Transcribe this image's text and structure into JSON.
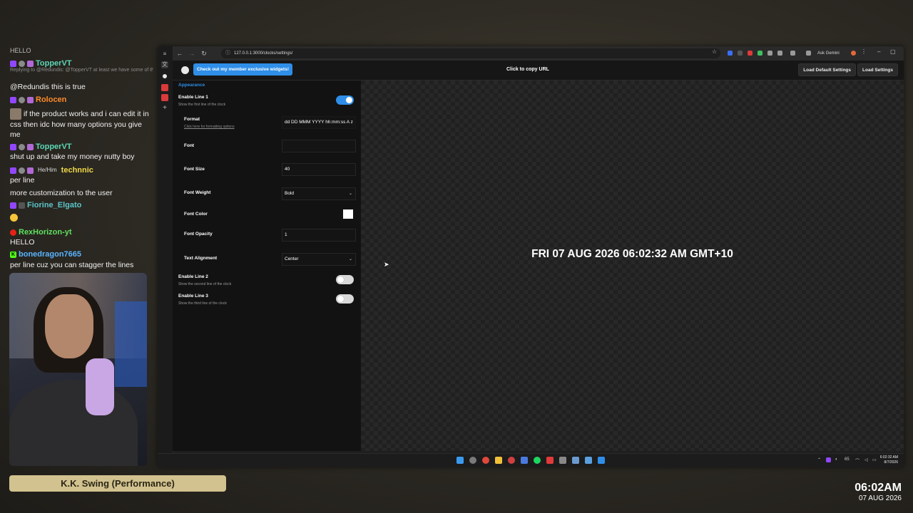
{
  "chat": {
    "top_fragment": "HELLO",
    "messages": [
      {
        "user": "TopperVT",
        "color": "#5cd6b6",
        "reply_text": "Replying to @Redundis: @TopperVT at least we have some of the best musical artists in town",
        "text": "@Redundis this is true"
      },
      {
        "user": "Rolocen",
        "color": "#ff8a2b",
        "text": "if the product works and i can edit it in css then idc how many options you give me"
      },
      {
        "user": "TopperVT",
        "color": "#5cd6b6",
        "text": "shut up and take my money nutty boy"
      },
      {
        "user": "technnic",
        "color": "#f0d84a",
        "pronoun": "He/Him",
        "text": "per line"
      },
      {
        "user": "",
        "text": "more customization to the user"
      },
      {
        "user": "Fiorine_Elgato",
        "color": "#5cc4c8",
        "text": ""
      },
      {
        "user": "RexHorizon-yt",
        "color": "#5fe05f",
        "text": "HELLO"
      },
      {
        "user": "bonedragon7665",
        "color": "#5ab4ff",
        "text": "per line cuz you can stagger the lines"
      }
    ]
  },
  "now_playing": "K.K. Swing (Performance)",
  "stream_clock": {
    "time": "06:02AM",
    "date": "07 AUG 2026"
  },
  "browser": {
    "url": "127.0.0.1:3000/clocks/settings/",
    "ask_gemini": "Ask Gemini",
    "header": {
      "member_button": "Check out my member exclusive widgets!",
      "copy_url": "Click to copy URL",
      "load_default": "Load Default Settings",
      "load_settings": "Load Settings"
    },
    "panel": {
      "section": "Appearance",
      "line1": {
        "title": "Enable Line 1",
        "sub": "Show the first line of the clock",
        "enabled": true
      },
      "format": {
        "label": "Format",
        "link": "Click here for formatting options",
        "value": "dd DD MMM YYYY hh:mm:ss A z"
      },
      "font": {
        "label": "Font",
        "value": ""
      },
      "font_size": {
        "label": "Font Size",
        "value": "40"
      },
      "font_weight": {
        "label": "Font Weight",
        "value": "Bold"
      },
      "font_color": {
        "label": "Font Color",
        "value": "#ffffff"
      },
      "font_opacity": {
        "label": "Font Opacity",
        "value": "1"
      },
      "text_alignment": {
        "label": "Text Alignment",
        "value": "Center"
      },
      "line2": {
        "title": "Enable Line 2",
        "sub": "Show the second line of the clock",
        "enabled": false
      },
      "line3": {
        "title": "Enable Line 3",
        "sub": "Show the third line of the clock",
        "enabled": false
      }
    },
    "preview_text": "FRI 07 AUG 2026 06:02:32 AM GMT+10"
  },
  "taskbar": {
    "time": "6:02:32 AM",
    "date": "8/7/2026",
    "tray_temp": "65"
  },
  "colors": {
    "accent": "#2f8ee8",
    "song_bar": "#d2c28f"
  }
}
